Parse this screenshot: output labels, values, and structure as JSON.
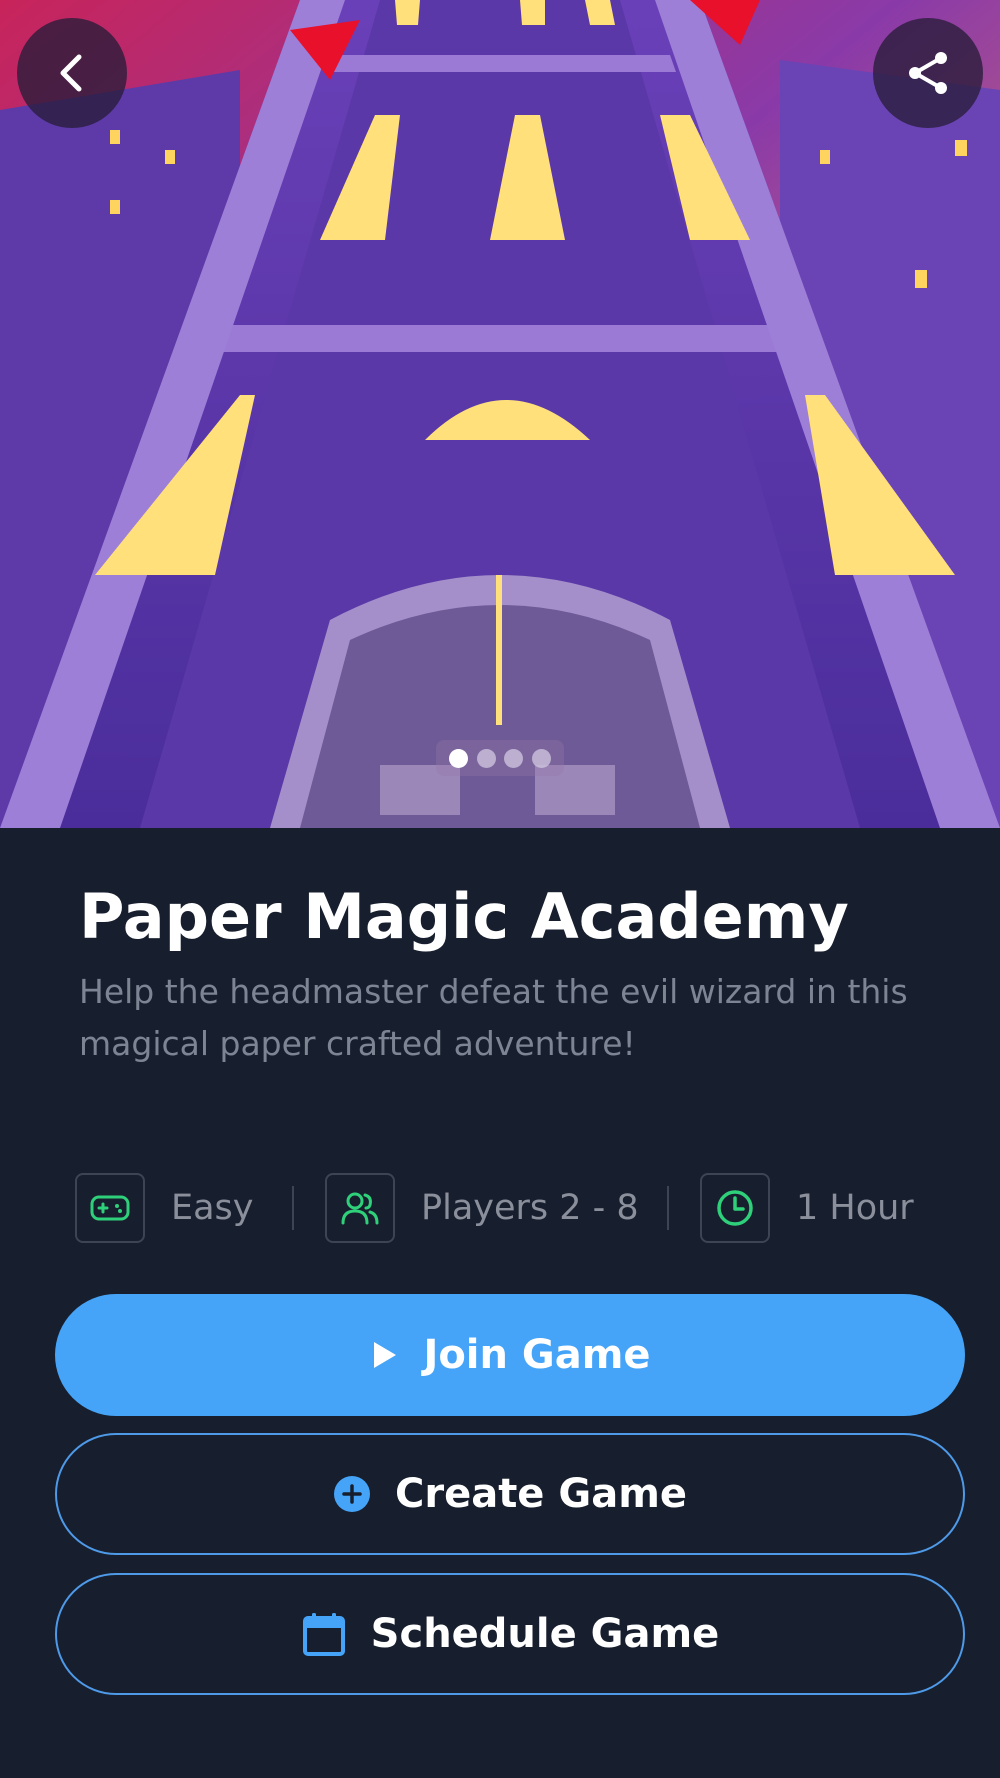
{
  "hero": {
    "carousel": {
      "count": 4,
      "active": 0
    },
    "icons": {
      "back": "chevron-left-icon",
      "share": "share-icon"
    }
  },
  "game": {
    "title": "Paper Magic Academy",
    "description": "Help the headmaster defeat the evil wizard in this magical paper crafted adventure!"
  },
  "meta": {
    "difficulty": "Easy",
    "players": "Players 2 - 8",
    "duration": "1 Hour"
  },
  "actions": {
    "join": "Join Game",
    "create": "Create Game",
    "schedule": "Schedule Game"
  },
  "colors": {
    "background": "#171e2d",
    "accent": "#45a4f7",
    "meta_icon": "#2fd07a",
    "text_muted": "#7d8493"
  }
}
